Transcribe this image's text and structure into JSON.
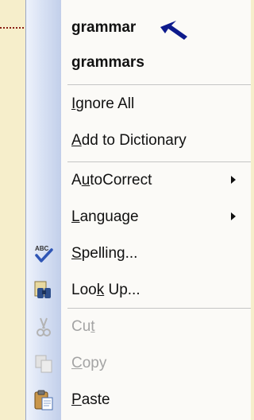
{
  "menu": {
    "suggestions": [
      {
        "label": "grammar"
      },
      {
        "label": "grammars"
      }
    ],
    "items": [
      {
        "pre": "",
        "key": "I",
        "post": "gnore All"
      },
      {
        "pre": "",
        "key": "A",
        "post": "dd to Dictionary"
      },
      {
        "pre": "A",
        "key": "u",
        "post": "toCorrect",
        "submenu": true
      },
      {
        "pre": "",
        "key": "L",
        "post": "anguage",
        "submenu": true
      },
      {
        "pre": "",
        "key": "S",
        "post": "pelling...",
        "icon": "spelling-abc-check-icon",
        "icon_text": "ABC"
      },
      {
        "pre": "Loo",
        "key": "k",
        "post": " Up...",
        "icon": "research-binoculars-icon"
      },
      {
        "pre": "Cu",
        "key": "t",
        "post": "",
        "icon": "scissors-icon",
        "disabled": true
      },
      {
        "pre": "",
        "key": "C",
        "post": "opy",
        "icon": "copy-icon",
        "disabled": true
      },
      {
        "pre": "",
        "key": "P",
        "post": "aste",
        "icon": "clipboard-paste-icon"
      }
    ]
  },
  "colors": {
    "pointer": "#8a2015",
    "annotation_arrow": "#0d1a8c",
    "disabled_text": "#a4a4a4"
  }
}
